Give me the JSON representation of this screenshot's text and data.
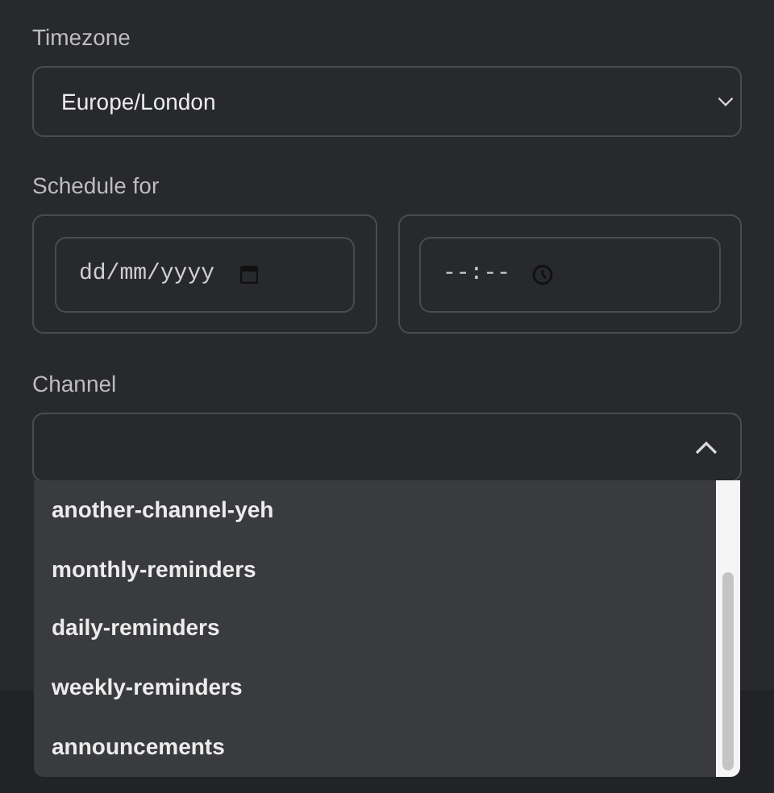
{
  "timezone": {
    "label": "Timezone",
    "value": "Europe/London",
    "expanded": false
  },
  "schedule": {
    "label": "Schedule for",
    "date": {
      "placeholder": "dd/mm/yyyy"
    },
    "time": {
      "placeholder": "--:--"
    }
  },
  "channel": {
    "label": "Channel",
    "expanded": true,
    "options": [
      {
        "label": "another-channel-yeh"
      },
      {
        "label": "monthly-reminders"
      },
      {
        "label": "daily-reminders"
      },
      {
        "label": "weekly-reminders"
      },
      {
        "label": "announcements"
      }
    ]
  }
}
